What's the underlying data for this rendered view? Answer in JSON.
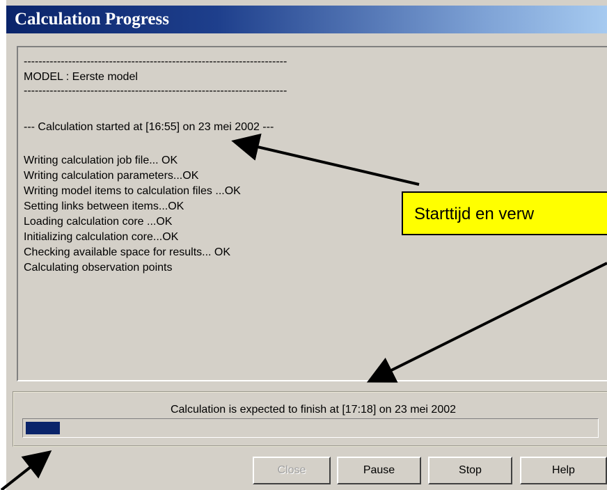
{
  "window": {
    "title": "Calculation Progress"
  },
  "log": {
    "lines": [
      "-----------------------------------------------------------------------",
      "MODEL : Eerste model",
      "-----------------------------------------------------------------------",
      "--- Calculation started at  [16:55] on 23 mei 2002 ---",
      "Writing calculation job file... OK",
      "Writing calculation parameters...OK",
      "Writing model items to calculation files ...OK",
      "Setting links between items...OK",
      "Loading calculation core ...OK",
      "Initializing calculation core...OK",
      "Checking available space for results... OK",
      "Calculating observation points"
    ]
  },
  "status": {
    "expected_finish": "Calculation is expected to finish at  [17:18] on 23 mei 2002"
  },
  "progress": {
    "fraction": 0.06,
    "color": "#0a246a"
  },
  "buttons": {
    "close": "Close",
    "pause": "Pause",
    "stop": "Stop",
    "help": "Help"
  },
  "annotation": {
    "callout_text": "Starttijd en verw",
    "callout_color": "#ffff00"
  }
}
